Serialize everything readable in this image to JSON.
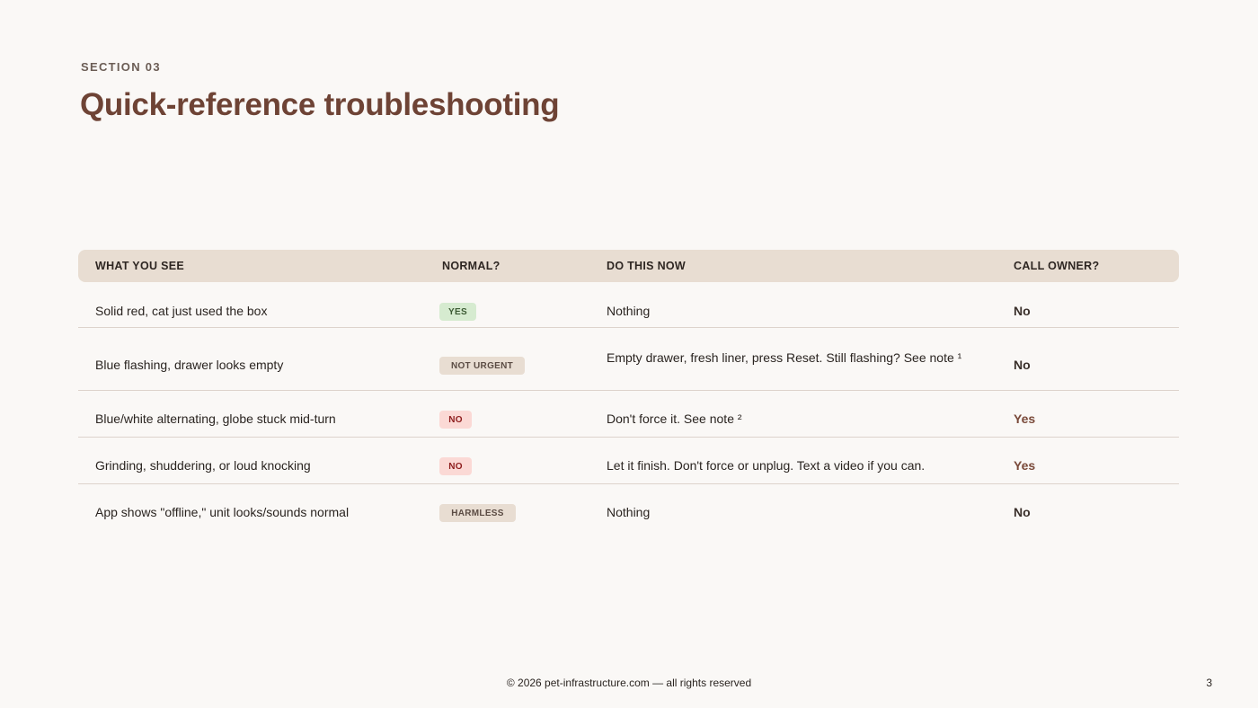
{
  "section": "SECTION 03",
  "title": "Quick-reference troubleshooting",
  "table": {
    "headers": [
      "WHAT YOU SEE",
      "NORMAL?",
      "DO THIS NOW",
      "CALL OWNER?"
    ],
    "rows": [
      {
        "see": "Solid red, cat just used the box",
        "normal": "YES",
        "normal_style": "green",
        "action": "Nothing",
        "owner": "No"
      },
      {
        "see": "Blue flashing, drawer looks empty",
        "normal": "NOT URGENT",
        "normal_style": "beige",
        "action": "Empty drawer, fresh liner, press Reset. Still flashing? See note ¹",
        "owner": "No"
      },
      {
        "see": "Blue/white alternating, globe stuck mid-turn",
        "normal": "NO",
        "normal_style": "red",
        "action": "Don't force it. See note ²",
        "owner": "Yes"
      },
      {
        "see": "Grinding, shuddering, or loud knocking",
        "normal": "NO",
        "normal_style": "red",
        "action": "Let it finish. Don't force or unplug. Text a video if you can.",
        "owner": "Yes"
      },
      {
        "see": "App shows \"offline,\" unit looks/sounds normal",
        "normal": "HARMLESS",
        "normal_style": "beige",
        "action": "Nothing",
        "owner": "No"
      }
    ]
  },
  "footer": "© 2026 pet-infrastructure.com — all rights reserved",
  "page_number": "3",
  "colors": {
    "background": "#faf8f6",
    "title": "#6e4335",
    "header_band": "#e8ddd2",
    "pill_green": "#d6ebd0",
    "pill_red": "#fbd9d5",
    "pill_beige": "#e8ddd2",
    "owner_yes": "#7a4a3a"
  }
}
